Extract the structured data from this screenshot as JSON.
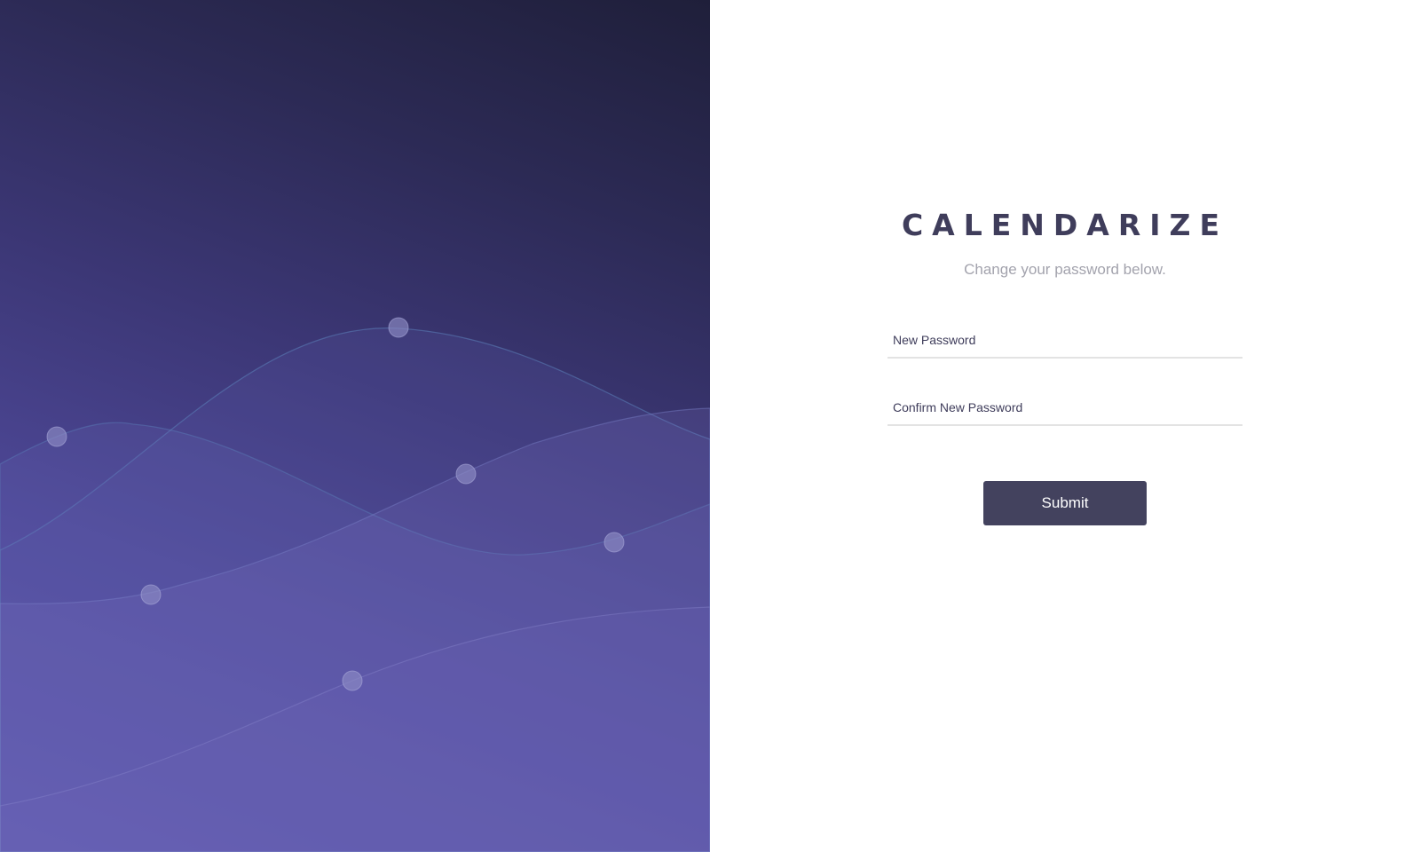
{
  "brand": {
    "name": "CALENDARIZE",
    "subtitle": "Change your password below."
  },
  "form": {
    "new_password": {
      "value": "",
      "placeholder": "New Password"
    },
    "confirm_password": {
      "value": "",
      "placeholder": "Confirm New Password"
    },
    "submit_label": "Submit"
  },
  "colors": {
    "brand_text": "#3f3d5b",
    "subtitle_text": "#a3a3ad",
    "button_bg": "#43425e",
    "button_text": "#ffffff",
    "field_underline": "#e3e3e3",
    "hero_dark": "#1f1f3a",
    "hero_light": "#5e57b0"
  }
}
